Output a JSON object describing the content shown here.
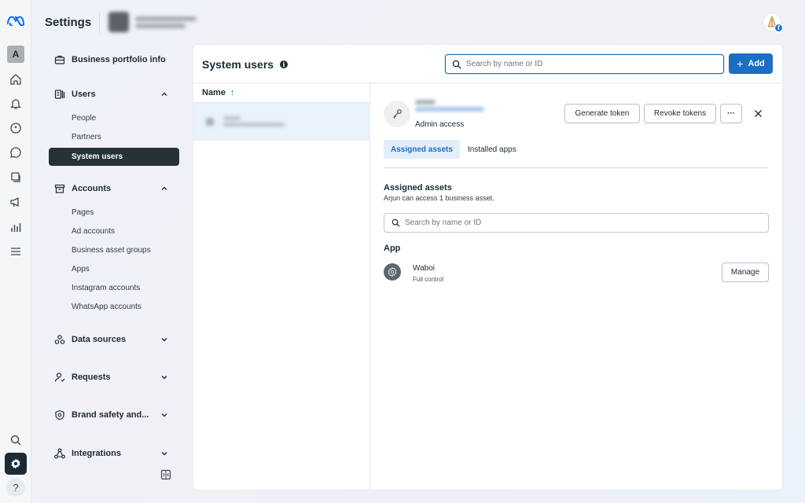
{
  "app": {
    "title": "Settings",
    "account_initial": "A",
    "user_badge": "f"
  },
  "nav": {
    "business_portfolio_info": "Business portfolio info",
    "users_section": "Users",
    "users_items": [
      "People",
      "Partners",
      "System users"
    ],
    "accounts_section": "Accounts",
    "accounts_items": [
      "Pages",
      "Ad accounts",
      "Business asset groups",
      "Apps",
      "Instagram accounts",
      "WhatsApp accounts"
    ],
    "data_sources": "Data sources",
    "requests": "Requests",
    "brand_safety": "Brand safety and...",
    "integrations": "Integrations"
  },
  "main": {
    "title": "System users",
    "search_placeholder": "Search by name or ID",
    "add_label": "Add",
    "list_header": "Name"
  },
  "detail": {
    "role": "Admin access",
    "generate_token": "Generate token",
    "revoke_tokens": "Revoke tokens",
    "more": "···",
    "tabs": [
      "Assigned assets",
      "Installed apps"
    ],
    "assets_title": "Assigned assets",
    "assets_subtitle": "Arjun can access 1 business asset.",
    "assets_search_placeholder": "Search by name or ID",
    "group_label": "App",
    "asset_name": "Waboi",
    "asset_permission": "Full control",
    "manage_label": "Manage"
  },
  "colors": {
    "accent": "#1b6fc2",
    "active_nav": "#263238",
    "selected_row": "#e9f1fb"
  },
  "icons": [
    "meta-logo-icon",
    "home-icon",
    "notifications-icon",
    "explore-icon",
    "messages-icon",
    "content-icon",
    "ads-icon",
    "insights-icon",
    "menu-icon",
    "search-icon",
    "gear-icon",
    "help-icon"
  ]
}
